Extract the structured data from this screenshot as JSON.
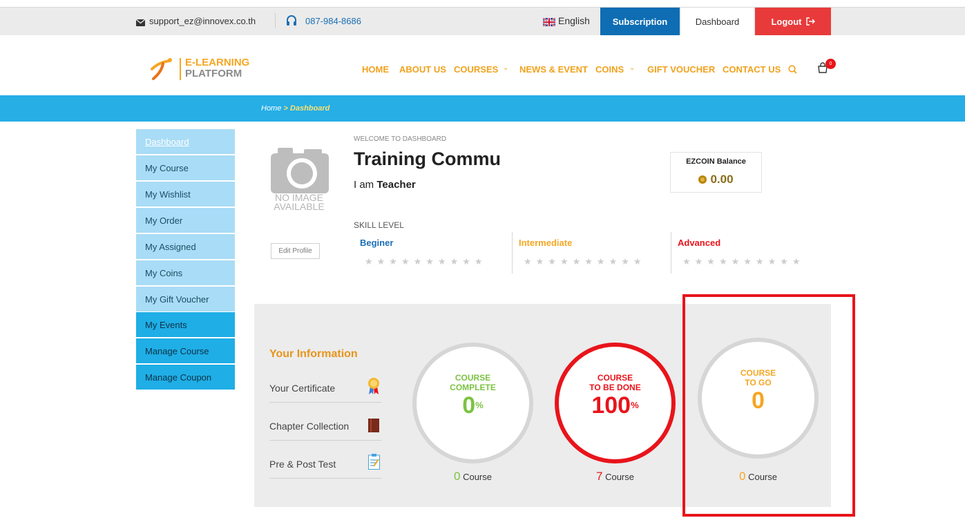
{
  "topbar": {
    "email": "support_ez@innovex.co.th",
    "phone": "087-984-8686",
    "language": "English",
    "subscription": "Subscription",
    "dashboard": "Dashboard",
    "logout": "Logout"
  },
  "logo": {
    "line1": "E-LEARNING",
    "line2": "PLATFORM"
  },
  "nav": {
    "home": "HOME",
    "about": "ABOUT US",
    "courses": "COURSES",
    "news": "NEWS & EVENT",
    "coins": "COINS",
    "gift": "GIFT VOUCHER",
    "contact": "CONTACT US",
    "cart_count": "0"
  },
  "breadcrumb": {
    "home": "Home",
    "sep": " > ",
    "current": "Dashboard"
  },
  "sidebar": [
    "Dashboard",
    "My Course",
    "My Wishlist",
    "My Order",
    "My Assigned",
    "My Coins",
    "My Gift Voucher",
    "My Events",
    "Manage Course",
    "Manage Coupon"
  ],
  "profile": {
    "no_image_line1": "NO IMAGE",
    "no_image_line2": "AVAILABLE",
    "edit_profile": "Edit Profile",
    "welcome": "WELCOME TO DASHBOARD",
    "name": "Training Commu",
    "role_prefix": "I am ",
    "role": "Teacher",
    "ezcoin_label": "EZCOIN Balance",
    "ezcoin_value": "0.00"
  },
  "skill": {
    "title": "SKILL LEVEL",
    "beginner": "Beginer",
    "intermediate": "Intermediate",
    "advanced": "Advanced",
    "stars": "★★★★★★★★★★"
  },
  "info": {
    "title": "Your Information",
    "certificate": "Your Certificate",
    "chapter": "Chapter Collection",
    "test": "Pre & Post Test"
  },
  "stats": {
    "complete_label1": "COURSE",
    "complete_label2": "COMPLETE",
    "complete_value": "0",
    "complete_unit": "%",
    "complete_count": "0",
    "todo_label1": "COURSE",
    "todo_label2": "TO BE DONE",
    "todo_value": "100",
    "todo_unit": "%",
    "todo_count": "7",
    "togo_label1": "COURSE",
    "togo_label2": "TO GO",
    "togo_value": "0",
    "togo_count": "0",
    "course_word": "Course"
  },
  "colors": {
    "green": "#7cc242",
    "red": "#e8141b",
    "orange": "#f5a623",
    "highlight": "#e8141b"
  }
}
